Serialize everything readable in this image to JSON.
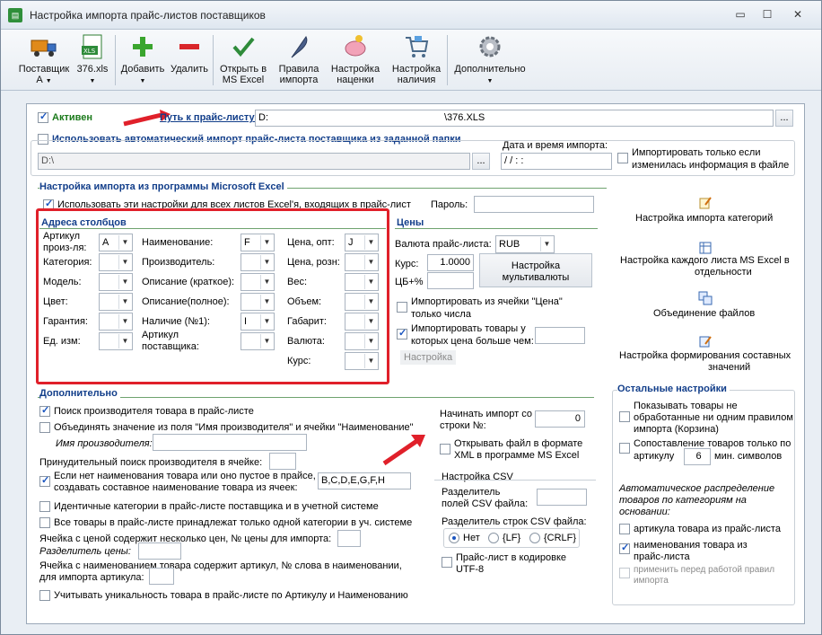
{
  "window": {
    "title": "Настройка импорта прайс-листов поставщиков",
    "minimize": "▭",
    "maximize": "☐",
    "close": "✕"
  },
  "toolbar": {
    "supplier_label": "Поставщик",
    "supplier_sub": "А",
    "file_label": "376.xls",
    "add_label": "Добавить",
    "delete_label": "Удалить",
    "open_excel_l1": "Открыть в",
    "open_excel_l2": "MS Excel",
    "rules_l1": "Правила",
    "rules_l2": "импорта",
    "markup_l1": "Настройка",
    "markup_l2": "наценки",
    "stock_l1": "Настройка",
    "stock_l2": "наличия",
    "more_label": "Дополнительно"
  },
  "top": {
    "active_label": "Активен",
    "path_label": "Путь к прайс-листу:",
    "path_value_a": "D:",
    "path_value_b": "\\376.XLS",
    "browse": "...",
    "auto_import_label": "Использовать автоматический импорт прайс-листа поставщика из заданной папки",
    "folder_value": "D:\\",
    "date_label": "Дата и время импорта:",
    "date_value": " /  /       :   :",
    "only_changed_l1": "Импортировать только если",
    "only_changed_l2": "изменилась информация в файле"
  },
  "excel": {
    "title": "Настройка импорта из программы Microsoft Excel",
    "use_all_sheets": "Использовать эти настройки для всех листов Excel'я, входящих в прайс-лист",
    "password_label": "Пароль:"
  },
  "columns": {
    "title": "Адреса столбцов",
    "col1": [
      {
        "label1": "Артикул",
        "label2": "произ-ля:",
        "value": "A"
      },
      {
        "label1": "Категория:",
        "value": ""
      },
      {
        "label1": "Модель:",
        "value": ""
      },
      {
        "label1": "Цвет:",
        "value": ""
      },
      {
        "label1": "Гарантия:",
        "value": ""
      },
      {
        "label1": "Ед. изм:",
        "value": ""
      }
    ],
    "col2": [
      {
        "label1": "Наименование:",
        "value": "F"
      },
      {
        "label1": "Производитель:",
        "value": ""
      },
      {
        "label1": "Описание (краткое):",
        "value": ""
      },
      {
        "label1": "Описание(полное):",
        "value": ""
      },
      {
        "label1": "Наличие (№1):",
        "value": "I"
      },
      {
        "label1": "Артикул",
        "label2": "поставщика:",
        "value": ""
      }
    ],
    "col3": [
      {
        "label1": "Цена, опт:",
        "value": "J"
      },
      {
        "label1": "Цена, розн:",
        "value": ""
      },
      {
        "label1": "Вес:",
        "value": ""
      },
      {
        "label1": "Объем:",
        "value": ""
      },
      {
        "label1": "Габарит:",
        "value": ""
      },
      {
        "label1": "Валюта:",
        "value": ""
      },
      {
        "label1": "Курс:",
        "value": ""
      }
    ]
  },
  "prices": {
    "title": "Цены",
    "currency_label": "Валюта прайс-листа:",
    "currency_value": "RUB",
    "rate_label": "Курс:",
    "rate_value": "1.0000",
    "cb_label": "ЦБ+%",
    "multi_btn_l1": "Настройка",
    "multi_btn_l2": "мультивалюты",
    "from_cell_l1": "Импортировать из ячейки \"Цена\"",
    "from_cell_l2": "только числа",
    "above_l1": "Импортировать товары у",
    "above_l2": "которых цена больше чем:",
    "setup_btn": "Настройка"
  },
  "extra": {
    "title": "Дополнительно",
    "search_maker": "Поиск производителя товара в прайс-листе",
    "merge": "Объединять значение из поля \"Имя производителя\" и ячейки \"Наименование\"",
    "maker_name_label": "Имя производителя:",
    "forced_search_label": "Принудительный поиск производителя в ячейке:",
    "compose_l1": "Если нет наименования товара или оно пустое в прайсе,",
    "compose_l2": "создавать составное наименование товара из ячеек:",
    "compose_value": "B,C,D,E,G,F,H",
    "same_categories": "Идентичные категории в прайс-листе поставщика и в учетной системе",
    "one_category": "Все товары в прайс-листе принадлежат только одной категории в уч. системе",
    "multi_price_label": "Ячейка с ценой содержит несколько цен, № цены для импорта:",
    "price_sep_label": "Разделитель цены:",
    "article_in_name_l1": "Ячейка с наименованием товара содержит артикул, № слова в наименовании,",
    "article_in_name_l2": "для импорта артикула:",
    "unique_label": "Учитывать уникальность товара в прайс-листе по Артикулу и Наименованию"
  },
  "start": {
    "start_l1": "Начинать импорт со",
    "start_l2": "строки №:",
    "start_value": "0",
    "xml_l1": "Открывать файл в формате",
    "xml_l2": "XML в программе MS Excel"
  },
  "csv": {
    "title": "Настройка CSV",
    "field_sep_l1": "Разделитель",
    "field_sep_l2": "полей CSV файла:",
    "row_sep_label": "Разделитель строк CSV файла:",
    "opt_none": "Нет",
    "opt_lf": "{LF}",
    "opt_crlf": "{CRLF}",
    "utf8_l1": "Прайс-лист в кодировке",
    "utf8_l2": "UTF-8"
  },
  "links": {
    "categories": "Настройка импорта категорий",
    "sheets_l1": "Настройка каждого листа MS Excel в",
    "sheets_l2": "отдельности",
    "merge_files": "Объединение файлов",
    "composite_l1": "Настройка формирования составных",
    "composite_l2": "значений"
  },
  "other": {
    "title": "Остальные настройки",
    "show_unprocessed_l1": "Показывать товары не",
    "show_unprocessed_l2": "обработанные ни одним правилом",
    "show_unprocessed_l3": "импорта (Корзина)",
    "compare_l1": "Сопоставление товаров только по",
    "compare_l2": "артикулу",
    "compare_value": "6",
    "compare_l3": "мин. символов",
    "auto_dist_l1": "Автоматическое распределение",
    "auto_dist_l2": "товаров по категориям на",
    "auto_dist_l3": "основании:",
    "by_article": "артикула товара из прайс-листа",
    "by_name_l1": "наименования товара из",
    "by_name_l2": "прайс-листа",
    "apply_l1": "применить перед работой правил",
    "apply_l2": "импорта"
  }
}
